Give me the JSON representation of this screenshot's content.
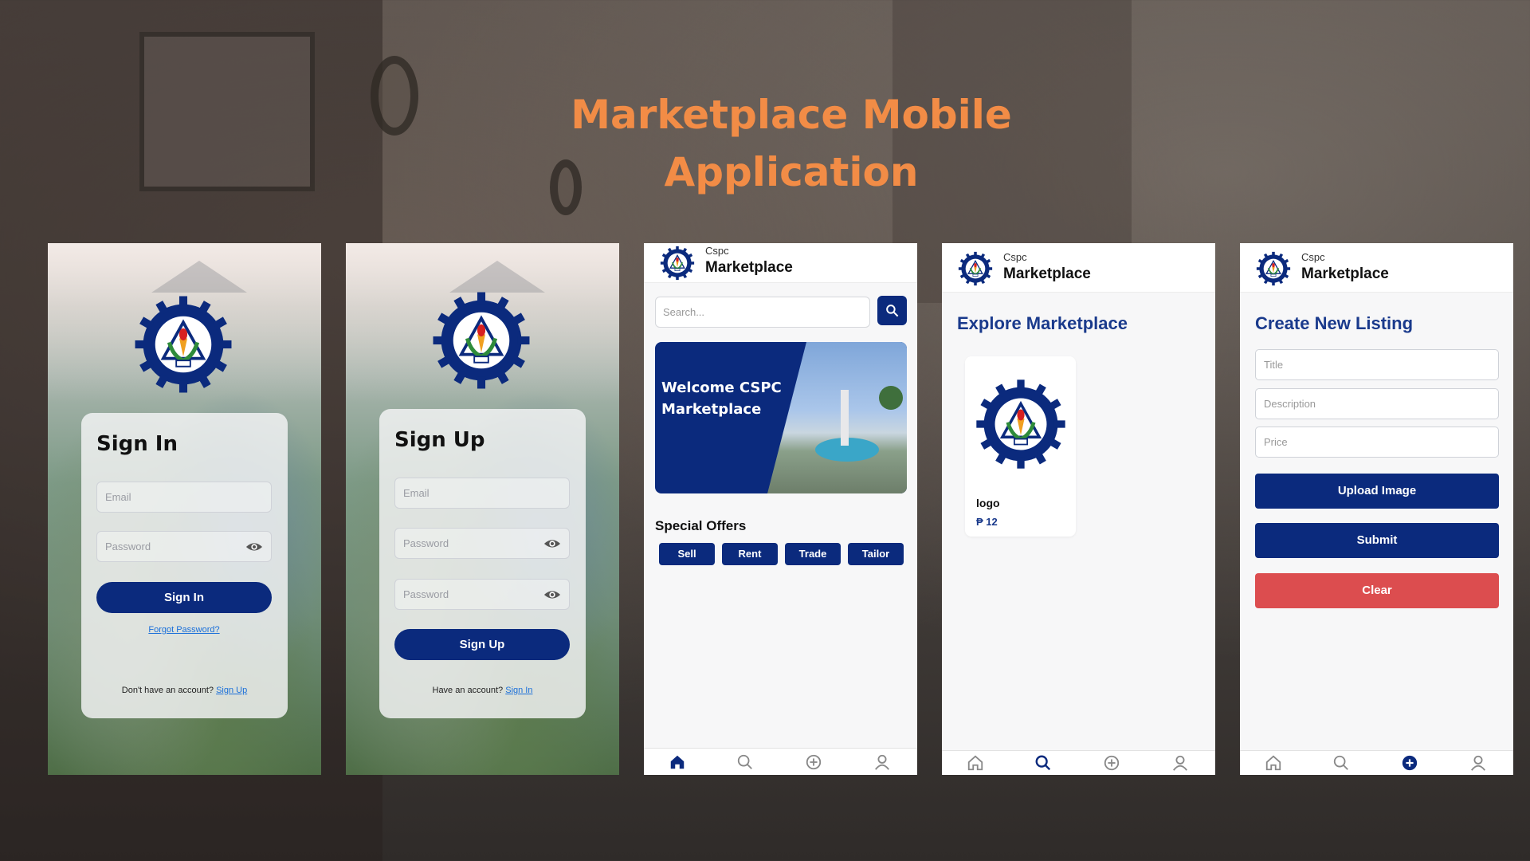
{
  "headline": {
    "line1": "Marketplace Mobile",
    "line2": "Application"
  },
  "colors": {
    "navy": "#0b2a7d",
    "accent_orange": "#f28c46",
    "clear_red": "#dc4d4f",
    "title_blue": "#1a3a8c"
  },
  "signin": {
    "title": "Sign In",
    "email_placeholder": "Email",
    "password_placeholder": "Password",
    "button": "Sign In",
    "forgot": "Forgot Password?",
    "footer_text": "Don't have an account?",
    "footer_link": "Sign Up"
  },
  "signup": {
    "title": "Sign Up",
    "email_placeholder": "Email",
    "password_placeholder": "Password",
    "confirm_placeholder": "Password",
    "button": "Sign Up",
    "footer_text": "Have an account?",
    "footer_link": "Sign In"
  },
  "header": {
    "small": "Cspc",
    "big": "Marketplace"
  },
  "home": {
    "search_placeholder": "Search...",
    "banner_text": "Welcome CSPC Marketplace",
    "section_title": "Special Offers",
    "offers": [
      "Sell",
      "Rent",
      "Trade",
      "Tailor"
    ]
  },
  "explore": {
    "title": "Explore Marketplace",
    "item": {
      "name": "logo",
      "price": "₱ 12"
    }
  },
  "create": {
    "title": "Create New Listing",
    "title_placeholder": "Title",
    "description_placeholder": "Description",
    "price_placeholder": "Price",
    "upload_button": "Upload Image",
    "submit_button": "Submit",
    "clear_button": "Clear"
  },
  "nav_icons": [
    "home-icon",
    "search-icon",
    "add-circle-icon",
    "profile-icon"
  ],
  "active_nav": {
    "home": "home-icon",
    "explore": "search-icon",
    "create": "add-circle-icon"
  }
}
